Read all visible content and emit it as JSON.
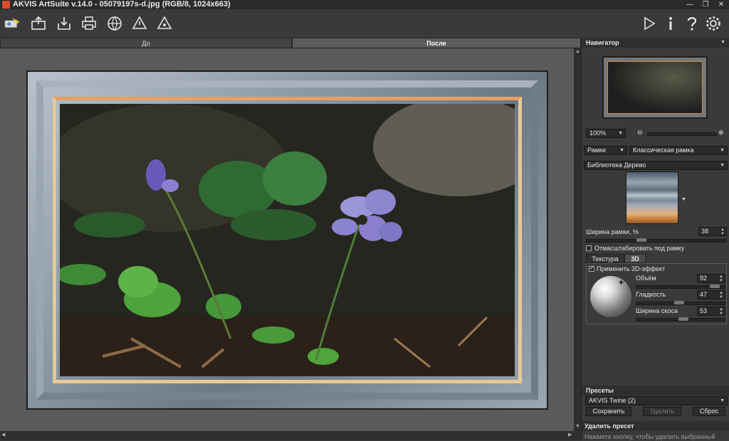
{
  "window": {
    "title": "AKVIS ArtSuite v.14.0 - 05079197s-d.jpg (RGB/8, 1024x663)",
    "controls": [
      "—",
      "❐",
      "✕"
    ]
  },
  "toolbar": {
    "items": [
      "app-logo",
      "open-icon",
      "save-icon",
      "print-icon",
      "share-icon",
      "batch-icon",
      "plugin-icon"
    ],
    "right": [
      "run-icon",
      "info-icon",
      "help-icon",
      "settings-icon"
    ]
  },
  "tabs": {
    "before": "До",
    "after": "После"
  },
  "navigator": {
    "title": "Навигатор",
    "zoom": "100%"
  },
  "effect": {
    "category": "Рамки",
    "type": "Классическая рамка",
    "library_label": "Библиотека",
    "library_value": "Дерево",
    "width_label": "Ширина рамки, %",
    "width_value": "38",
    "width_fraction": 0.38,
    "scale_label": "Отмасштабировать под рамку",
    "scale_checked": false
  },
  "subtabs": {
    "texture": "Текстура",
    "threed": "3D"
  },
  "threed": {
    "apply_label": "Применить 3D-эффект",
    "apply_checked": true,
    "volume_label": "Объём",
    "volume_value": "92",
    "volume_fraction": 0.92,
    "smooth_label": "Гладкость",
    "smooth_value": "47",
    "smooth_fraction": 0.47,
    "bevel_label": "Ширина скоса",
    "bevel_value": "53",
    "bevel_fraction": 0.53
  },
  "presets": {
    "title": "Пресеты",
    "current": "AKVIS Twine (2)",
    "save_label": "Сохранить",
    "delete_label": "Удалить",
    "reset_label": "Сброс"
  },
  "hint": {
    "title": "Удалить пресет",
    "text": "Нажмите кнопку, чтобы удалить выбранный"
  }
}
